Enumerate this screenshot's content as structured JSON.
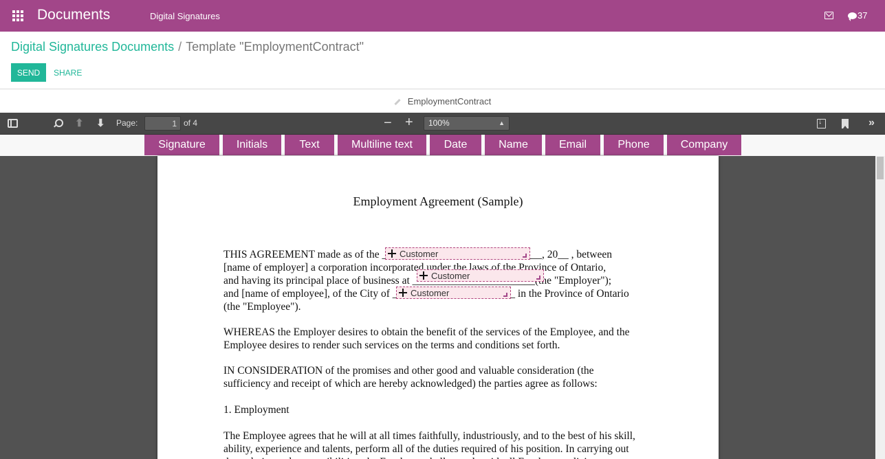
{
  "topbar": {
    "app_name": "Documents",
    "menu_item": "Digital Signatures",
    "messages_icon": "envelope-icon",
    "chat_count": "37"
  },
  "control_panel": {
    "breadcrumb_parent": "Digital Signatures Documents",
    "breadcrumb_separator": "/",
    "breadcrumb_current": "Template \"EmploymentContract\"",
    "send_label": "SEND",
    "share_label": "SHARE",
    "document_name": "EmploymentContract"
  },
  "pdf_toolbar": {
    "page_label": "Page:",
    "page_value": "1",
    "page_total": "of 4",
    "zoom_out": "−",
    "zoom_in": "+",
    "zoom_value": "100%"
  },
  "field_types": [
    "Signature",
    "Initials",
    "Text",
    "Multiline text",
    "Date",
    "Name",
    "Email",
    "Phone",
    "Company"
  ],
  "document": {
    "title": "Employment Agreement (Sample)",
    "paragraphs": [
      "THIS AGREEMENT made as of the ______________________________, 20__ , between\n[name of employer] a corporation incorporated under the laws of the Province of Ontario,\nand having its principal place of business at _______________________(the \"Employer\");\nand [name of employee], of the City of _______________________ in the Province of Ontario\n(the \"Employee\").",
      "WHEREAS the Employer desires to obtain the benefit of the services of the Employee, and the\nEmployee desires to render such services on the terms and conditions set forth.",
      "IN CONSIDERATION of the promises and other good and valuable consideration (the\nsufficiency and receipt of which are hereby acknowledged) the parties agree as follows:",
      "1. Employment",
      "The Employee agrees that he will at all times faithfully, industriously, and to the best of his skill,\nability, experience and talents, perform all of the duties required of his position. In carrying out\nthese duties and responsibilities, the Employee shall comply with all Employer policies,"
    ],
    "placed_fields": [
      "Customer",
      "Customer",
      "Customer"
    ]
  }
}
